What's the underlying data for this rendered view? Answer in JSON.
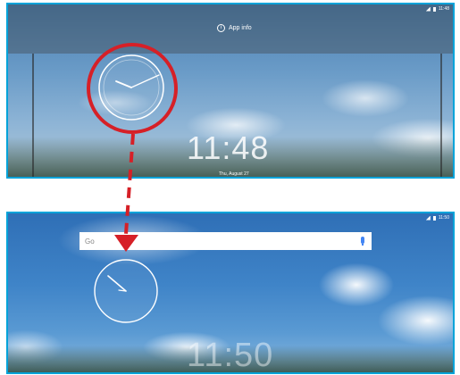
{
  "top_screen": {
    "status_time": "11:48",
    "app_info_label": "App info",
    "clock_time": "11:48",
    "date": "Thu, August 27"
  },
  "bottom_screen": {
    "status_time": "11:50",
    "search_text": "Go",
    "clock_time": "11:50"
  },
  "colors": {
    "panel_border": "#00a3d9",
    "annotation_red": "#d62027"
  }
}
